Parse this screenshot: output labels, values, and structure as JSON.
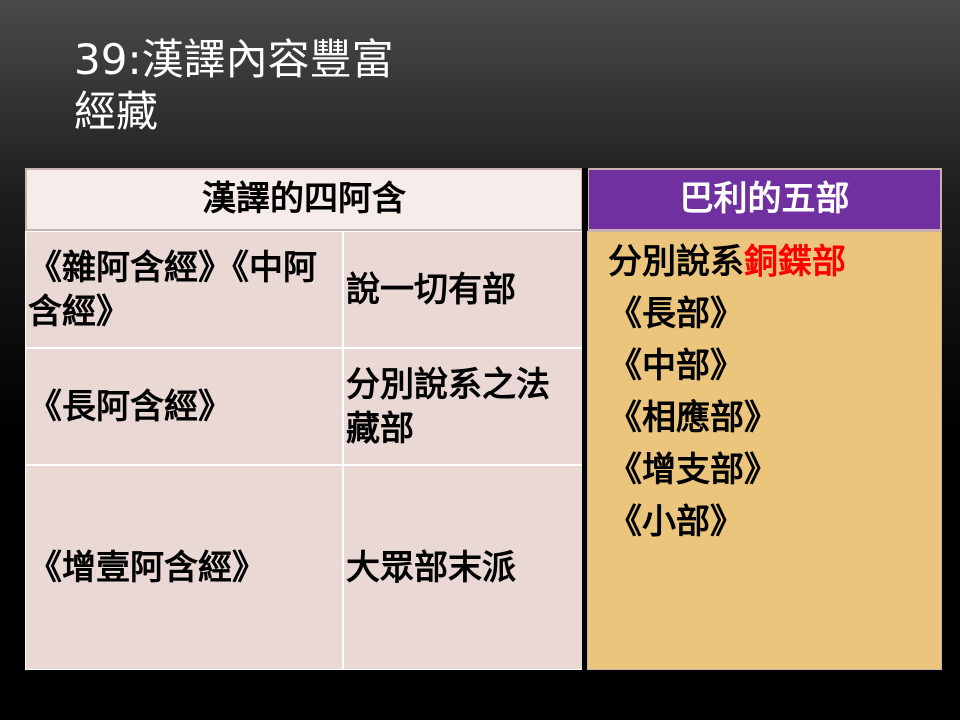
{
  "slide": {
    "title_line1": "39:漢譯內容豐富",
    "title_line2": "經藏"
  },
  "table": {
    "left_header": "漢譯的四阿含",
    "right_header": "巴利的五部",
    "rows": [
      {
        "text": "《雜阿含經》《中阿含經》",
        "school": "說一切有部"
      },
      {
        "text": "《長阿含經》",
        "school": "分別說系之法藏部"
      },
      {
        "text": "《增壹阿含經》",
        "school": "大眾部末派"
      }
    ],
    "pali": {
      "school_prefix": "分別說系",
      "school_highlight": "銅鍱部",
      "highlight_color": "#ff0000",
      "nikayas": [
        "《長部》",
        "《中部》",
        "《相應部》",
        "《增支部》",
        "《小部》"
      ]
    }
  }
}
